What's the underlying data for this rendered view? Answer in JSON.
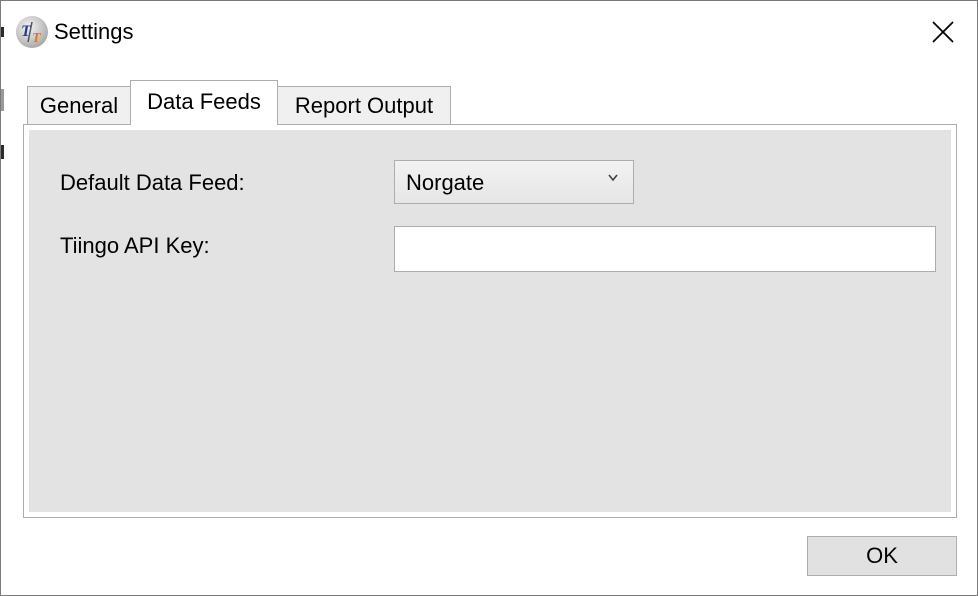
{
  "window": {
    "title": "Settings"
  },
  "tabs": [
    {
      "label": "General",
      "active": false
    },
    {
      "label": "Data Feeds",
      "active": true
    },
    {
      "label": "Report Output",
      "active": false
    }
  ],
  "form": {
    "default_feed_label": "Default Data Feed:",
    "default_feed_value": "Norgate",
    "tiingo_key_label": "Tiingo API Key:",
    "tiingo_key_value": ""
  },
  "footer": {
    "ok_label": "OK"
  },
  "colors": {
    "panel_bg": "#e3e3e3",
    "border": "#adadad",
    "button_bg": "#e1e1e1"
  },
  "icons": {
    "app": "app-logo-icon",
    "close": "close-icon",
    "dropdown": "chevron-down-icon"
  }
}
